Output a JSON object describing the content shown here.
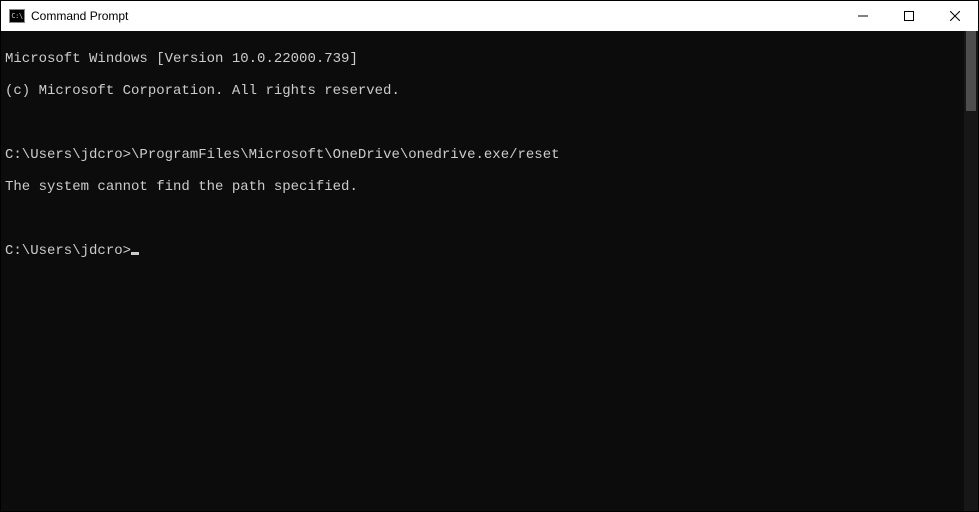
{
  "window": {
    "title": "Command Prompt"
  },
  "terminal": {
    "line1": "Microsoft Windows [Version 10.0.22000.739]",
    "line2": "(c) Microsoft Corporation. All rights reserved.",
    "blank1": "",
    "prompt1_prefix": "C:\\Users\\jdcro>",
    "prompt1_cmd": "\\ProgramFiles\\Microsoft\\OneDrive\\onedrive.exe/reset",
    "error1": "The system cannot find the path specified.",
    "blank2": "",
    "prompt2_prefix": "C:\\Users\\jdcro>"
  }
}
